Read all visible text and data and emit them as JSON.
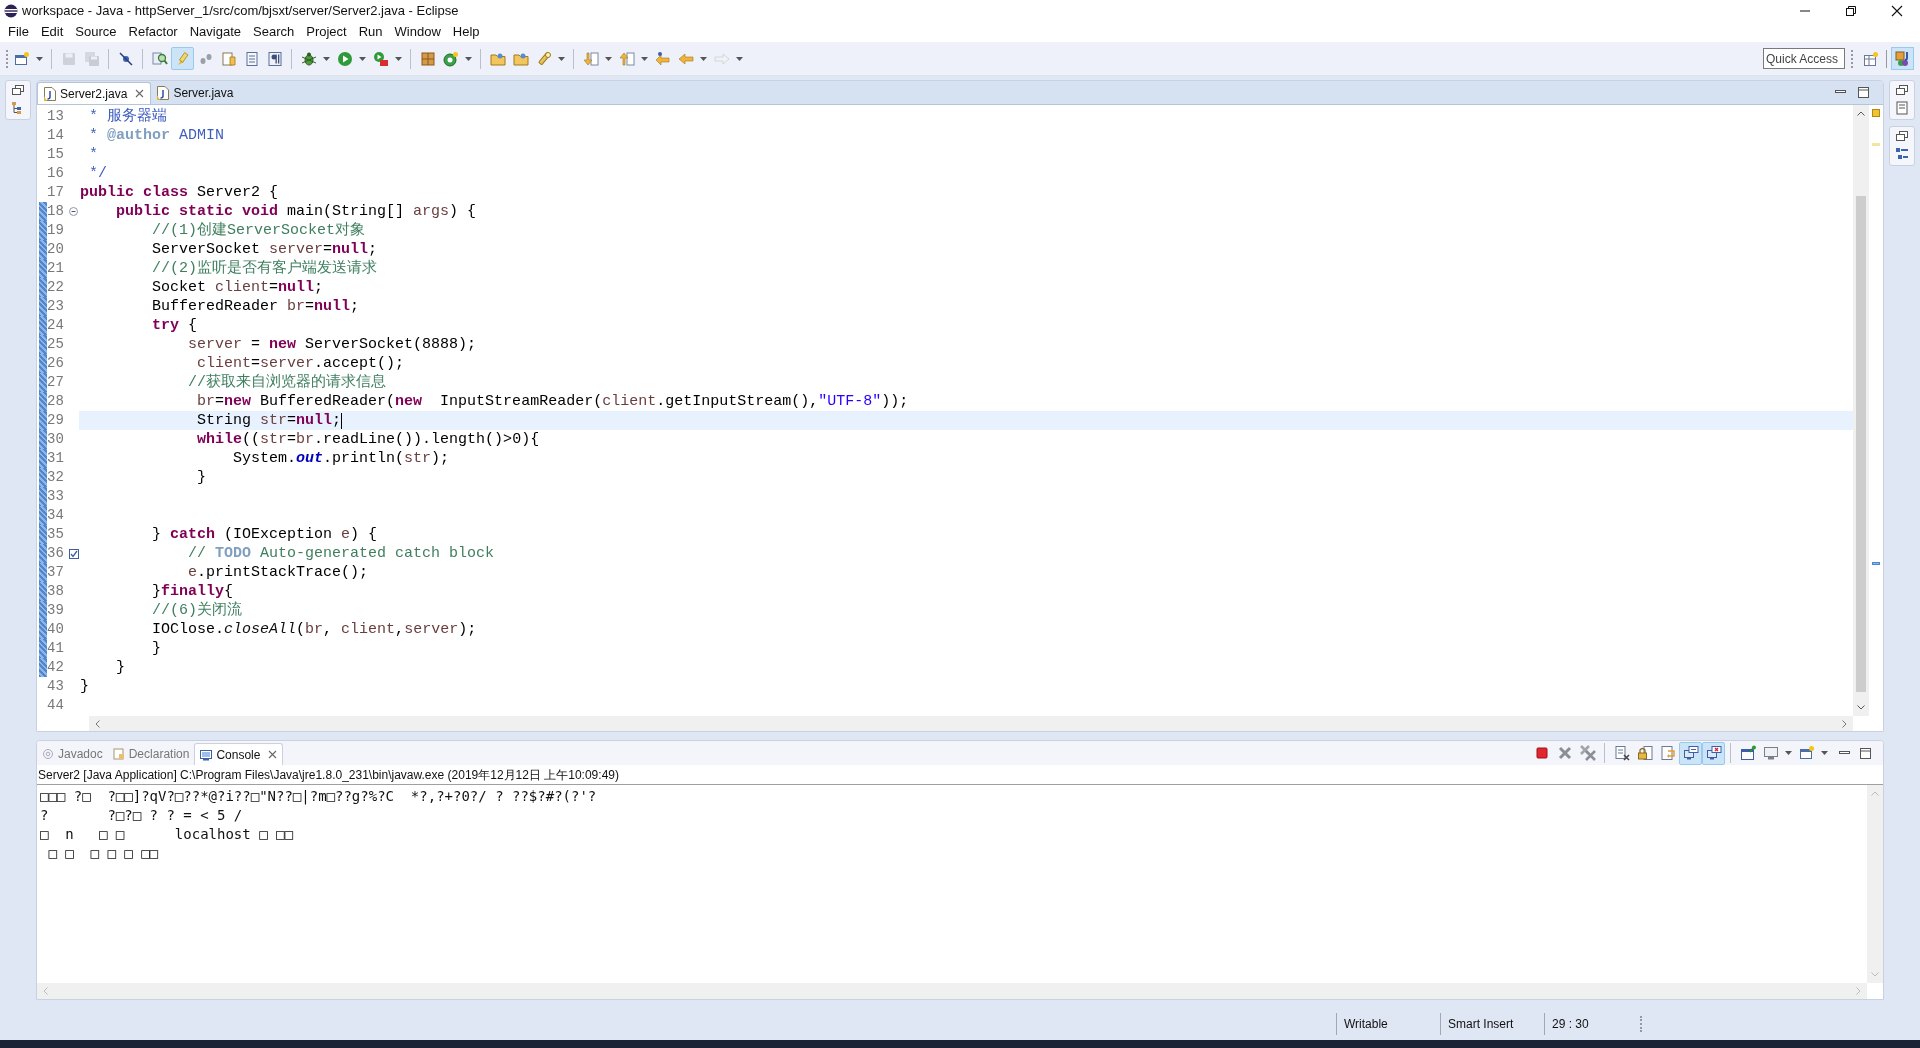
{
  "window": {
    "title": "workspace - Java - httpServer_1/src/com/bjsxt/server/Server2.java - Eclipse"
  },
  "menu": [
    "File",
    "Edit",
    "Source",
    "Refactor",
    "Navigate",
    "Search",
    "Project",
    "Run",
    "Window",
    "Help"
  ],
  "toolbar": [
    {
      "kind": "new",
      "dropdown": true,
      "pressed": false,
      "disabled": false
    },
    {
      "kind": "sep"
    },
    {
      "kind": "save",
      "dropdown": false,
      "pressed": false,
      "disabled": true
    },
    {
      "kind": "save-all",
      "dropdown": false,
      "pressed": false,
      "disabled": true
    },
    {
      "kind": "sep"
    },
    {
      "kind": "skip",
      "dropdown": false,
      "pressed": false,
      "disabled": false
    },
    {
      "kind": "sep"
    },
    {
      "kind": "find",
      "dropdown": false,
      "pressed": false,
      "disabled": false
    },
    {
      "kind": "highlight",
      "dropdown": false,
      "pressed": true,
      "disabled": false
    },
    {
      "kind": "dots",
      "dropdown": false,
      "pressed": false,
      "disabled": false
    },
    {
      "kind": "document",
      "dropdown": false,
      "pressed": false,
      "disabled": false
    },
    {
      "kind": "page",
      "dropdown": false,
      "pressed": false,
      "disabled": false
    },
    {
      "kind": "paragraph",
      "dropdown": false,
      "pressed": false,
      "disabled": false
    },
    {
      "kind": "sep"
    },
    {
      "kind": "bug",
      "dropdown": true,
      "pressed": false,
      "disabled": false
    },
    {
      "kind": "run",
      "dropdown": true,
      "pressed": false,
      "disabled": false
    },
    {
      "kind": "external",
      "dropdown": true,
      "pressed": false,
      "disabled": false
    },
    {
      "kind": "sep"
    },
    {
      "kind": "package",
      "dropdown": false,
      "pressed": false,
      "disabled": false
    },
    {
      "kind": "class",
      "dropdown": true,
      "pressed": false,
      "disabled": false
    },
    {
      "kind": "sep"
    },
    {
      "kind": "folder",
      "dropdown": false,
      "pressed": false,
      "disabled": false
    },
    {
      "kind": "folder",
      "dropdown": false,
      "pressed": false,
      "disabled": false
    },
    {
      "kind": "flashlight",
      "dropdown": true,
      "pressed": false,
      "disabled": false
    },
    {
      "kind": "sep"
    },
    {
      "kind": "next",
      "dropdown": true,
      "pressed": false,
      "disabled": false
    },
    {
      "kind": "prev",
      "dropdown": true,
      "pressed": false,
      "disabled": false
    },
    {
      "kind": "last-edit",
      "dropdown": false,
      "pressed": false,
      "disabled": false
    },
    {
      "kind": "back",
      "dropdown": true,
      "pressed": false,
      "disabled": false
    },
    {
      "kind": "forward",
      "dropdown": true,
      "pressed": false,
      "disabled": true
    }
  ],
  "quick_access": {
    "placeholder": "Quick Access"
  },
  "perspectives": [
    {
      "kind": "open",
      "pressed": false
    },
    {
      "kind": "java",
      "pressed": true
    }
  ],
  "editor": {
    "tabs": [
      {
        "label": "Server2.java",
        "selected": true
      },
      {
        "label": "Server.java",
        "selected": false
      }
    ],
    "lines": [
      {
        "number": "13",
        "changed": false,
        "current": false,
        "tokens": [
          {
            "kind": "doc",
            "text": " * 服务器端"
          }
        ]
      },
      {
        "number": "14",
        "changed": false,
        "current": false,
        "tokens": [
          {
            "kind": "doc",
            "text": " *"
          },
          {
            "kind": "tag",
            "text": " @author"
          },
          {
            "kind": "doc",
            "text": " ADMIN"
          }
        ]
      },
      {
        "number": "15",
        "changed": false,
        "current": false,
        "tokens": [
          {
            "kind": "doc",
            "text": " *"
          }
        ]
      },
      {
        "number": "16",
        "changed": false,
        "current": false,
        "tokens": [
          {
            "kind": "doc",
            "text": " */"
          }
        ]
      },
      {
        "number": "17",
        "changed": false,
        "current": false,
        "tokens": [
          {
            "kind": "keyword",
            "text": "public"
          },
          {
            "kind": "keyword",
            "text": " class"
          },
          {
            "kind": "plain",
            "text": " Server2 {"
          }
        ]
      },
      {
        "number": "18",
        "changed": true,
        "current": false,
        "kind": "fold",
        "tokens": [
          {
            "kind": "keyword",
            "text": "    public"
          },
          {
            "kind": "keyword",
            "text": " static"
          },
          {
            "kind": "keyword",
            "text": " void"
          },
          {
            "kind": "plain",
            "text": " main(String[]"
          },
          {
            "kind": "variable",
            "text": " args"
          },
          {
            "kind": "plain",
            "text": ") {"
          }
        ]
      },
      {
        "number": "19",
        "changed": true,
        "current": false,
        "tokens": [
          {
            "kind": "comment",
            "text": "        //(1)创建ServerSocket对象"
          }
        ]
      },
      {
        "number": "20",
        "changed": true,
        "current": false,
        "tokens": [
          {
            "kind": "plain",
            "text": "        ServerSocket"
          },
          {
            "kind": "variable",
            "text": " server"
          },
          {
            "kind": "plain",
            "text": "="
          },
          {
            "kind": "keyword",
            "text": "null"
          },
          {
            "kind": "plain",
            "text": ";"
          }
        ]
      },
      {
        "number": "21",
        "changed": true,
        "current": false,
        "tokens": [
          {
            "kind": "comment",
            "text": "        //(2)监听是否有客户端发送请求"
          }
        ]
      },
      {
        "number": "22",
        "changed": true,
        "current": false,
        "tokens": [
          {
            "kind": "plain",
            "text": "        Socket"
          },
          {
            "kind": "variable",
            "text": " client"
          },
          {
            "kind": "plain",
            "text": "="
          },
          {
            "kind": "keyword",
            "text": "null"
          },
          {
            "kind": "plain",
            "text": ";"
          }
        ]
      },
      {
        "number": "23",
        "changed": true,
        "current": false,
        "tokens": [
          {
            "kind": "plain",
            "text": "        BufferedReader"
          },
          {
            "kind": "variable",
            "text": " br"
          },
          {
            "kind": "plain",
            "text": "="
          },
          {
            "kind": "keyword",
            "text": "null"
          },
          {
            "kind": "plain",
            "text": ";"
          }
        ]
      },
      {
        "number": "24",
        "changed": true,
        "current": false,
        "tokens": [
          {
            "kind": "keyword",
            "text": "        try"
          },
          {
            "kind": "plain",
            "text": " {"
          }
        ]
      },
      {
        "number": "25",
        "changed": true,
        "current": false,
        "tokens": [
          {
            "kind": "variable",
            "text": "            server"
          },
          {
            "kind": "plain",
            "text": " ="
          },
          {
            "kind": "keyword",
            "text": " new"
          },
          {
            "kind": "plain",
            "text": " ServerSocket(8888);"
          }
        ]
      },
      {
        "number": "26",
        "changed": true,
        "current": false,
        "tokens": [
          {
            "kind": "variable",
            "text": "             client"
          },
          {
            "kind": "plain",
            "text": "="
          },
          {
            "kind": "variable",
            "text": "server"
          },
          {
            "kind": "plain",
            "text": ".accept();"
          }
        ]
      },
      {
        "number": "27",
        "changed": true,
        "current": false,
        "tokens": [
          {
            "kind": "comment",
            "text": "            //获取来自浏览器的请求信息"
          }
        ]
      },
      {
        "number": "28",
        "changed": true,
        "current": false,
        "tokens": [
          {
            "kind": "variable",
            "text": "             br"
          },
          {
            "kind": "plain",
            "text": "="
          },
          {
            "kind": "keyword",
            "text": "new"
          },
          {
            "kind": "plain",
            "text": " BufferedReader("
          },
          {
            "kind": "keyword",
            "text": "new"
          },
          {
            "kind": "plain",
            "text": "  InputStreamReader("
          },
          {
            "kind": "variable",
            "text": "client"
          },
          {
            "kind": "plain",
            "text": ".getInputStream(),"
          },
          {
            "kind": "string",
            "text": "\"UTF-8\""
          },
          {
            "kind": "plain",
            "text": "));"
          }
        ]
      },
      {
        "number": "29",
        "changed": true,
        "current": true,
        "tokens": [
          {
            "kind": "plain",
            "text": "             String"
          },
          {
            "kind": "variable",
            "text": " str"
          },
          {
            "kind": "plain",
            "text": "="
          },
          {
            "kind": "keyword",
            "text": "null"
          },
          {
            "kind": "plain",
            "text": ";"
          }
        ]
      },
      {
        "number": "30",
        "changed": true,
        "current": false,
        "tokens": [
          {
            "kind": "keyword",
            "text": "             while"
          },
          {
            "kind": "plain",
            "text": "(("
          },
          {
            "kind": "variable",
            "text": "str"
          },
          {
            "kind": "plain",
            "text": "="
          },
          {
            "kind": "variable",
            "text": "br"
          },
          {
            "kind": "plain",
            "text": ".readLine()).length()>0){"
          }
        ]
      },
      {
        "number": "31",
        "changed": true,
        "current": false,
        "tokens": [
          {
            "kind": "plain",
            "text": "                 System."
          },
          {
            "kind": "field",
            "text": "out"
          },
          {
            "kind": "plain",
            "text": ".println("
          },
          {
            "kind": "variable",
            "text": "str"
          },
          {
            "kind": "plain",
            "text": ");"
          }
        ]
      },
      {
        "number": "32",
        "changed": true,
        "current": false,
        "tokens": [
          {
            "kind": "plain",
            "text": "             }"
          }
        ]
      },
      {
        "number": "33",
        "changed": true,
        "current": false
      },
      {
        "number": "34",
        "changed": true,
        "current": false
      },
      {
        "number": "35",
        "changed": true,
        "current": false,
        "tokens": [
          {
            "kind": "plain",
            "text": "        }"
          },
          {
            "kind": "keyword",
            "text": " catch"
          },
          {
            "kind": "plain",
            "text": " (IOException"
          },
          {
            "kind": "variable",
            "text": " e"
          },
          {
            "kind": "plain",
            "text": ") {"
          }
        ]
      },
      {
        "number": "36",
        "changed": true,
        "current": false,
        "kind": "task",
        "tokens": [
          {
            "kind": "comment",
            "text": "            //"
          },
          {
            "kind": "tag",
            "text": " TODO"
          },
          {
            "kind": "comment",
            "text": " Auto-generated catch block"
          }
        ]
      },
      {
        "number": "37",
        "changed": true,
        "current": false,
        "tokens": [
          {
            "kind": "variable",
            "text": "            e"
          },
          {
            "kind": "plain",
            "text": ".printStackTrace();"
          }
        ]
      },
      {
        "number": "38",
        "changed": true,
        "current": false,
        "tokens": [
          {
            "kind": "plain",
            "text": "        }"
          },
          {
            "kind": "keyword",
            "text": "finally"
          },
          {
            "kind": "plain",
            "text": "{"
          }
        ]
      },
      {
        "number": "39",
        "changed": true,
        "current": false,
        "tokens": [
          {
            "kind": "comment",
            "text": "        //(6)关闭流"
          }
        ]
      },
      {
        "number": "40",
        "changed": true,
        "current": false,
        "tokens": [
          {
            "kind": "plain",
            "text": "        IOClose."
          },
          {
            "kind": "static-method",
            "text": "closeAll"
          },
          {
            "kind": "plain",
            "text": "("
          },
          {
            "kind": "variable",
            "text": "br"
          },
          {
            "kind": "plain",
            "text": ","
          },
          {
            "kind": "variable",
            "text": " client"
          },
          {
            "kind": "plain",
            "text": ","
          },
          {
            "kind": "variable",
            "text": "server"
          },
          {
            "kind": "plain",
            "text": ");"
          }
        ]
      },
      {
        "number": "41",
        "changed": true,
        "current": false,
        "tokens": [
          {
            "kind": "plain",
            "text": "        }"
          }
        ]
      },
      {
        "number": "42",
        "changed": true,
        "current": false,
        "tokens": [
          {
            "kind": "plain",
            "text": "    }"
          }
        ]
      },
      {
        "number": "43",
        "changed": false,
        "current": false,
        "tokens": [
          {
            "kind": "plain",
            "text": "}"
          }
        ]
      },
      {
        "number": "44",
        "changed": false,
        "current": false
      }
    ]
  },
  "bottom_panel": {
    "tabs": [
      {
        "label": "Javadoc",
        "kind": "javadoc",
        "selected": false
      },
      {
        "label": "Declaration",
        "kind": "declaration",
        "selected": false
      },
      {
        "label": "Console",
        "kind": "console",
        "selected": true
      }
    ],
    "toolbar": [
      {
        "kind": "terminate",
        "pressed": false,
        "dropdown": false
      },
      {
        "kind": "remove",
        "pressed": false,
        "dropdown": false
      },
      {
        "kind": "remove-all",
        "pressed": false,
        "dropdown": false
      },
      {
        "kind": "sep"
      },
      {
        "kind": "clear",
        "pressed": false,
        "dropdown": false
      },
      {
        "kind": "lock",
        "pressed": false,
        "dropdown": false
      },
      {
        "kind": "wrap",
        "pressed": false,
        "dropdown": false
      },
      {
        "kind": "stdout",
        "pressed": true,
        "dropdown": false
      },
      {
        "kind": "stderr",
        "pressed": true,
        "dropdown": false
      },
      {
        "kind": "sep"
      },
      {
        "kind": "pin",
        "pressed": false,
        "dropdown": false
      },
      {
        "kind": "display",
        "pressed": false,
        "dropdown": true
      },
      {
        "kind": "new",
        "pressed": false,
        "dropdown": true
      }
    ],
    "console_title": "Server2 [Java Application] C:\\Program Files\\Java\\jre1.8.0_231\\bin\\javaw.exe (2019年12月12日 上午10:09:49)",
    "output": [
      "□□□ ?□  ?□□]?qV?□??*@?i??□\"N??□|?m□??g?%?C  *?,?+?0?/ ? ??$?#?(?'?",
      "?       ?□?□ ? ? = < 5 /",
      "□  n   □ □      localhost □ □□",
      " □ □  □ □ □ □□"
    ]
  },
  "status_bar": {
    "mode": "Writable",
    "insert": "Smart Insert",
    "position": "29 : 30"
  }
}
